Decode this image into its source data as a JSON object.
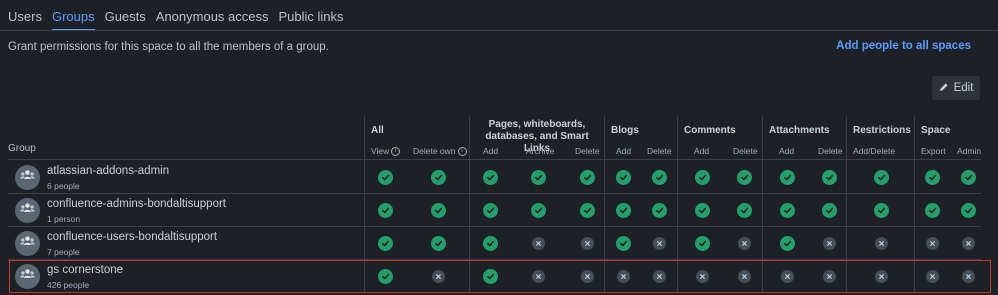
{
  "tabs": [
    "Users",
    "Groups",
    "Guests",
    "Anonymous access",
    "Public links"
  ],
  "active_tab": "Groups",
  "description": "Grant permissions for this space to all the members of a group.",
  "add_people_link": "Add people to all spaces",
  "edit_button": "Edit",
  "group_column_header": "Group",
  "column_groups": [
    {
      "label": "All",
      "cols": [
        "View",
        "Delete own"
      ]
    },
    {
      "label": "Pages, whiteboards, databases, and Smart Links",
      "cols": [
        "Add",
        "Archive",
        "Delete"
      ]
    },
    {
      "label": "Blogs",
      "cols": [
        "Add",
        "Delete"
      ]
    },
    {
      "label": "Comments",
      "cols": [
        "Add",
        "Delete"
      ]
    },
    {
      "label": "Attachments",
      "cols": [
        "Add",
        "Delete"
      ]
    },
    {
      "label": "Restrictions",
      "cols": [
        "Add/Delete"
      ]
    },
    {
      "label": "Space",
      "cols": [
        "Export",
        "Admin"
      ]
    }
  ],
  "rows": [
    {
      "name": "atlassian-addons-admin",
      "count": "6 people",
      "perms": [
        true,
        true,
        true,
        true,
        true,
        true,
        true,
        true,
        true,
        true,
        true,
        true,
        true,
        true
      ]
    },
    {
      "name": "confluence-admins-bondaltisupport",
      "count": "1 person",
      "perms": [
        true,
        true,
        true,
        true,
        true,
        true,
        true,
        true,
        true,
        true,
        true,
        true,
        true,
        true
      ]
    },
    {
      "name": "confluence-users-bondaltisupport",
      "count": "7 people",
      "perms": [
        true,
        true,
        true,
        false,
        false,
        true,
        false,
        true,
        false,
        true,
        false,
        false,
        false,
        false
      ]
    },
    {
      "name": "gs cornerstone",
      "count": "426 people",
      "highlighted": true,
      "perms": [
        true,
        false,
        true,
        false,
        false,
        false,
        false,
        false,
        false,
        false,
        false,
        false,
        false,
        false
      ]
    }
  ],
  "colors": {
    "accent": "#579dff",
    "granted": "#22a06b",
    "denied": "#454f59",
    "highlight": "#c9372c"
  },
  "icons": {
    "granted": "check-circle-icon",
    "denied": "cross-circle-icon",
    "edit": "pencil-icon",
    "avatar": "group-icon",
    "info": "info-icon"
  }
}
